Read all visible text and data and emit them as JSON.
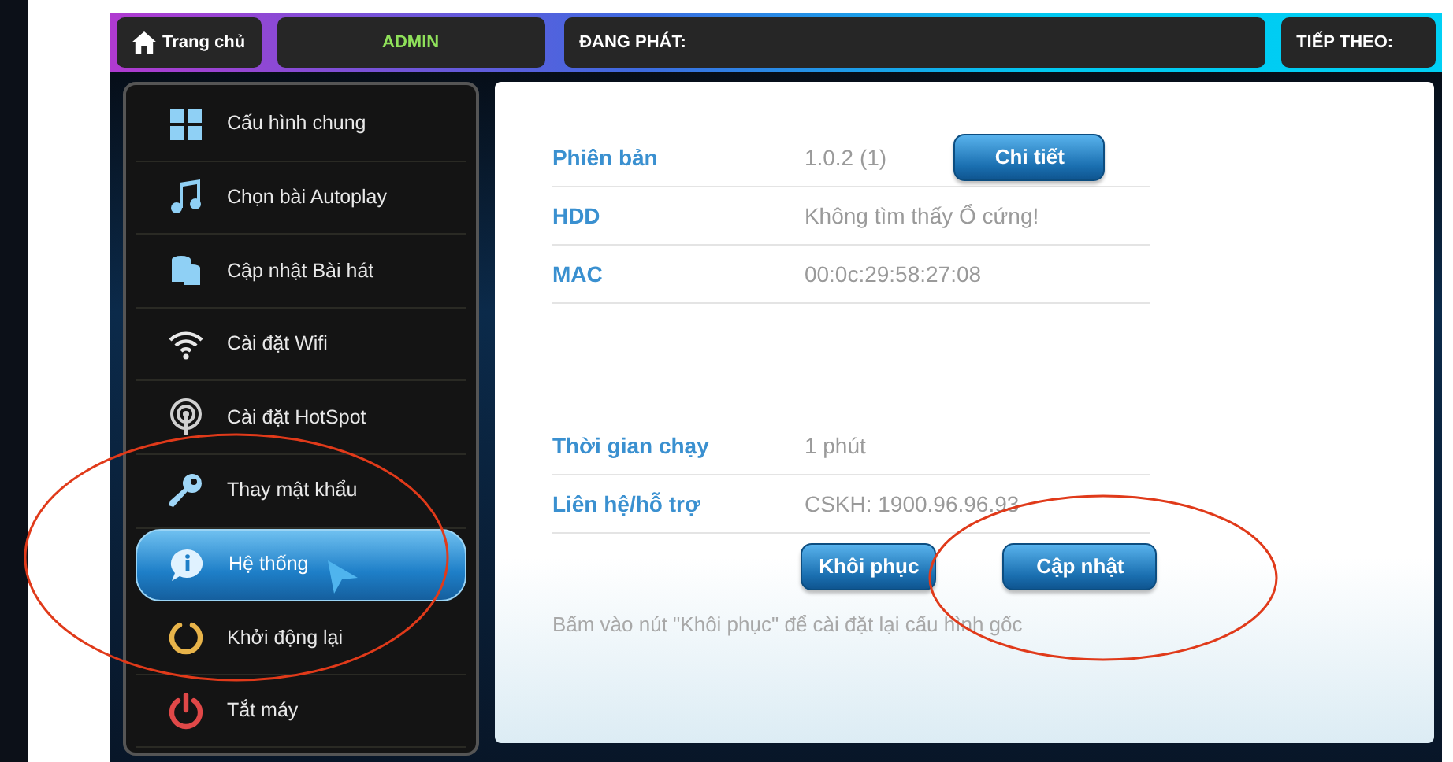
{
  "top_bar": {
    "home": "Trang chủ",
    "user": "ADMIN",
    "now_playing": "ĐANG PHÁT:",
    "next_up": "TIẾP THEO:"
  },
  "sidebar": {
    "items": [
      {
        "label": "Cấu hình chung",
        "kind": "grid",
        "selected": false
      },
      {
        "label": "Chọn bài Autoplay",
        "kind": "music",
        "selected": false
      },
      {
        "label": "Cập nhật Bài hát",
        "kind": "stack",
        "selected": false
      },
      {
        "label": "Cài đặt Wifi",
        "kind": "wifi",
        "selected": false
      },
      {
        "label": "Cài đặt HotSpot",
        "kind": "hotspot",
        "selected": false
      },
      {
        "label": "Thay mật khẩu",
        "kind": "key",
        "selected": false
      },
      {
        "label": "Hệ thống",
        "kind": "info",
        "selected": true
      },
      {
        "label": "Khởi động lại",
        "kind": "restart",
        "selected": false
      },
      {
        "label": "Tắt máy",
        "kind": "power",
        "selected": false
      }
    ]
  },
  "info": {
    "groups": [
      [
        {
          "label": "Phiên bản",
          "value": "1.0.2 (1)",
          "button": "Chi tiết"
        },
        {
          "label": "HDD",
          "value": "Không tìm thấy Ổ cứng!"
        },
        {
          "label": "MAC",
          "value": "00:0c:29:58:27:08"
        }
      ],
      [
        {
          "label": "Thời gian chạy",
          "value": "1 phút"
        },
        {
          "label": "Liên hệ/hỗ trợ",
          "value": "CSKH: 1900.96.96.93"
        }
      ]
    ],
    "actions": [
      "Khôi phục",
      "Cập nhật"
    ],
    "note": "Bấm vào nút \"Khôi phục\" để cài đặt lại cấu hình gốc"
  }
}
